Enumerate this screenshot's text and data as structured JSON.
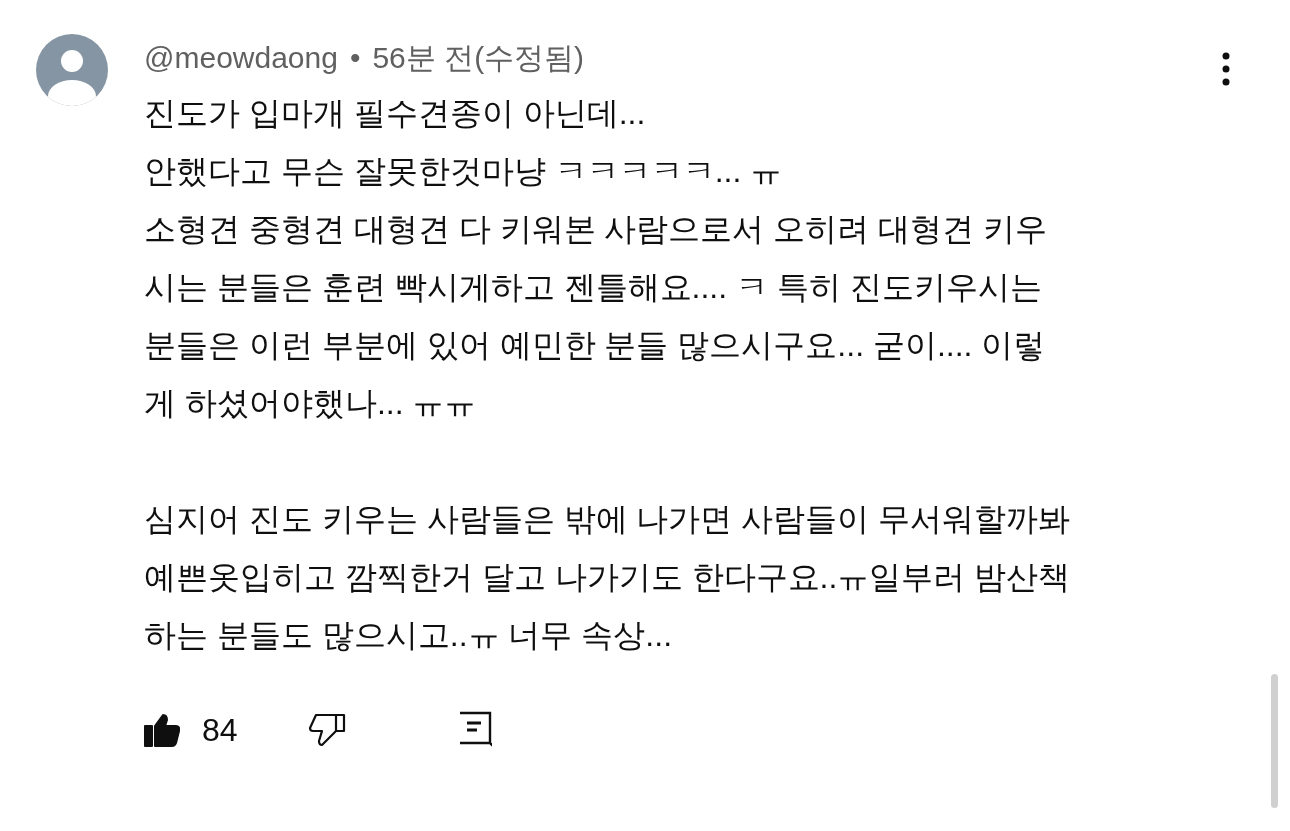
{
  "comment": {
    "author": "@meowdaong",
    "separator": "•",
    "time": "56분 전(수정됨)",
    "paragraphs": [
      "진도가 입마개 필수견종이 아닌데...\n안했다고 무슨 잘못한것마냥 ㅋㅋㅋㅋㅋ... ㅠ\n소형견 중형견 대형견 다 키워본 사람으로서 오히려 대형견 키우\n시는 분들은 훈련 빡시게하고 젠틀해요.... ㅋ 특히 진도키우시는\n분들은 이런 부분에 있어 예민한 분들 많으시구요... 굳이.... 이렇\n게 하셨어야했나... ㅠㅠ",
      "심지어 진도 키우는 사람들은 밖에 나가면 사람들이 무서워할까봐\n예쁜옷입히고 깜찍한거 달고 나가기도 한다구요..ㅠ일부러 밤산책\n하는 분들도 많으시고..ㅠ 너무 속상..."
    ],
    "likes": "84",
    "liked": true,
    "disliked": false
  }
}
